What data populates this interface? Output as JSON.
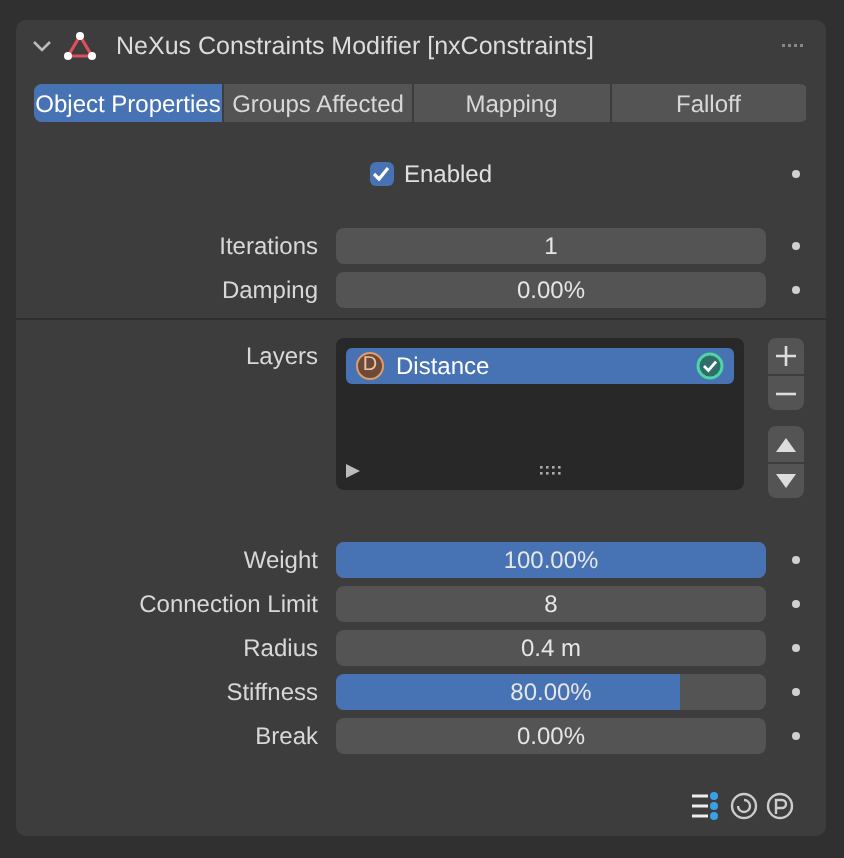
{
  "panel": {
    "title": "NeXus Constraints Modifier [nxConstraints]",
    "expanded": true
  },
  "tabs": [
    {
      "label": "Object Properties",
      "selected": true
    },
    {
      "label": "Groups Affected",
      "selected": false
    },
    {
      "label": "Mapping",
      "selected": false
    },
    {
      "label": "Falloff",
      "selected": false
    }
  ],
  "enabled": {
    "label": "Enabled",
    "checked": true
  },
  "top_fields": [
    {
      "label": "Iterations",
      "value": "1"
    },
    {
      "label": "Damping",
      "value": "0.00%",
      "level": 0
    }
  ],
  "layers": {
    "label": "Layers",
    "items": [
      {
        "badge": "D",
        "name": "Distance",
        "selected": true,
        "active": true
      }
    ]
  },
  "fields": [
    {
      "label": "Weight",
      "value": "100.00%",
      "level": 1
    },
    {
      "label": "Connection Limit",
      "value": "8"
    },
    {
      "label": "Radius",
      "value": "0.4 m"
    },
    {
      "label": "Stiffness",
      "value": "80.00%",
      "level": 0.8
    },
    {
      "label": "Break",
      "value": "0.00%",
      "level": 0
    }
  ]
}
